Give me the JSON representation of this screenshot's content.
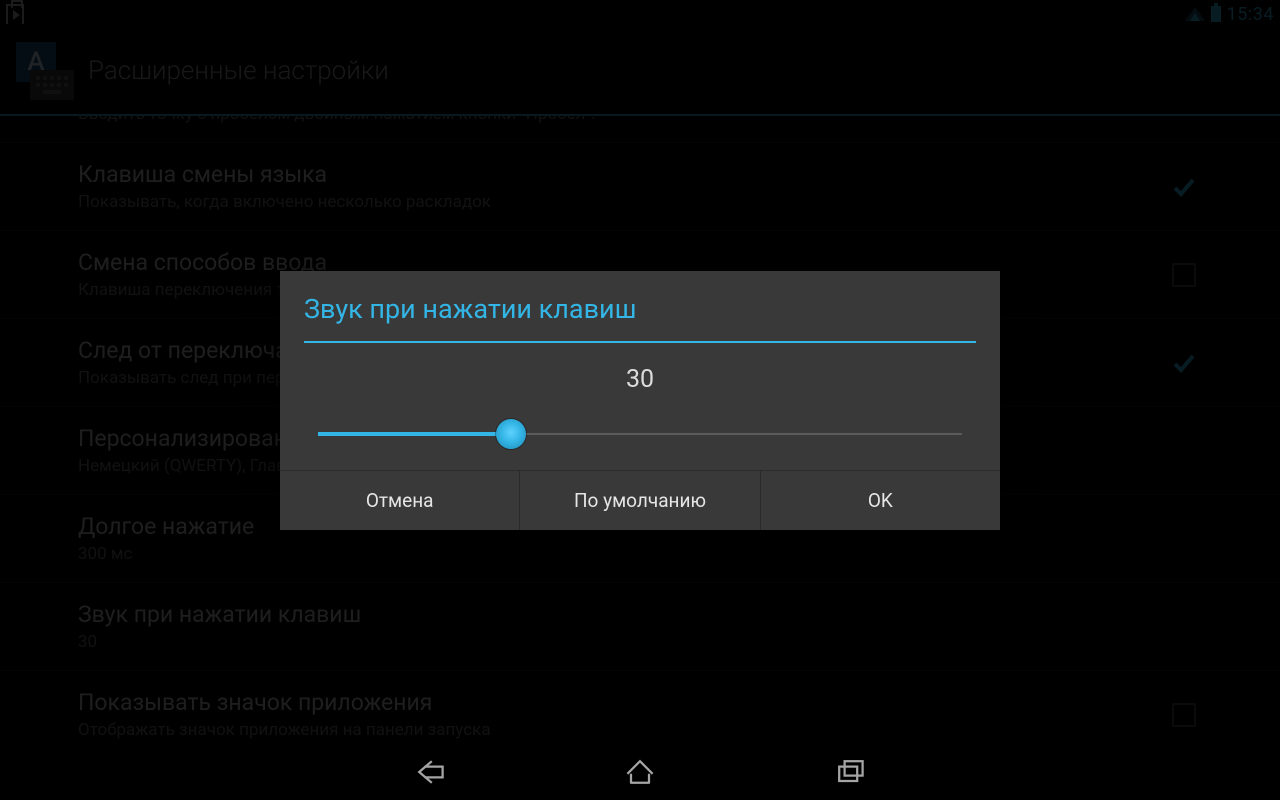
{
  "status": {
    "time": "15:34"
  },
  "header": {
    "title": "Расширенные настройки",
    "langLetter": "A"
  },
  "settings": [
    {
      "title": "",
      "sub": "Вводить точку с пробелом двойным нажатием кнопки \"Пробел\"."
    },
    {
      "title": "Клавиша смены языка",
      "sub": "Показывать, когда включено несколько раскладок",
      "checked": true
    },
    {
      "title": "Смена способов ввода",
      "sub": "Клавиша переключения также служит для смены других способов ввода",
      "checkbox": true
    },
    {
      "title": "След от переключателя",
      "sub": "Показывать след при перемещении переключателя",
      "checked": true
    },
    {
      "title": "Персонализированные словари",
      "sub": "Немецкий (QWERTY), Главный словарь"
    },
    {
      "title": "Долгое нажатие",
      "sub": "300 мс"
    },
    {
      "title": "Звук при нажатии клавиш",
      "sub": "30"
    },
    {
      "title": "Показывать значок приложения",
      "sub": "Отображать значок приложения на панели запуска",
      "checkbox": true
    }
  ],
  "dialog": {
    "title": "Звук при нажатии клавиш",
    "value": "30",
    "percent": 30,
    "buttons": {
      "cancel": "Отмена",
      "default": "По умолчанию",
      "ok": "OK"
    }
  }
}
